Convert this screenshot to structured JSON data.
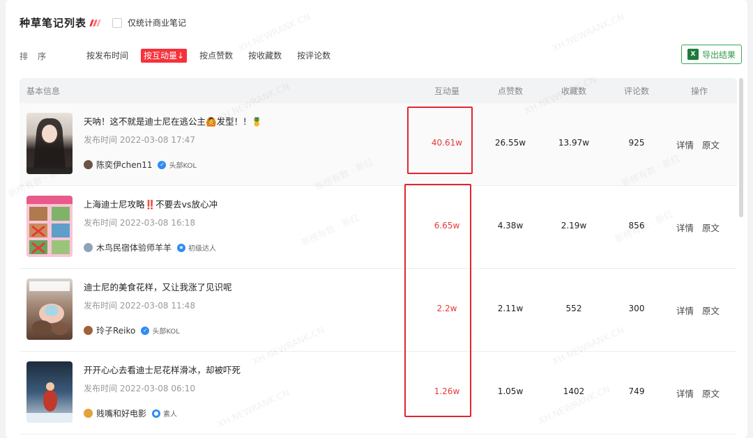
{
  "header": {
    "title": "种草笔记列表",
    "checkbox_label": "仅统计商业笔记"
  },
  "sort": {
    "label": "排序",
    "options": [
      "按发布时间",
      "按互动量↓",
      "按点赞数",
      "按收藏数",
      "按评论数"
    ],
    "active_index": 1
  },
  "export": {
    "label": "导出结果",
    "icon": "excel-icon"
  },
  "table": {
    "headers": {
      "info": "基本信息",
      "interactions": "互动量",
      "likes": "点赞数",
      "favorites": "收藏数",
      "comments": "评论数",
      "actions": "操作"
    },
    "rows": [
      {
        "title": "天呐！这不就是迪士尼在逃公主🙆发型！！🍍",
        "time": "发布时间 2022-03-08 17:47",
        "author": "陈奕伊chen11",
        "badge": "头部KOL",
        "interactions": "40.61w",
        "likes": "26.55w",
        "favorites": "13.97w",
        "comments": "925",
        "detail": "详情",
        "original": "原文"
      },
      {
        "title": "上海迪士尼攻略‼️不要去vs放心冲",
        "time": "发布时间 2022-03-08 16:18",
        "author": "木鸟民宿体验师羊羊",
        "badge": "初级达人",
        "interactions": "6.65w",
        "likes": "4.38w",
        "favorites": "2.19w",
        "comments": "856",
        "detail": "详情",
        "original": "原文"
      },
      {
        "title": "迪士尼的美食花样，又让我涨了见识呢",
        "time": "发布时间 2022-03-08 11:48",
        "author": "玲子Reiko",
        "badge": "头部KOL",
        "interactions": "2.2w",
        "likes": "2.11w",
        "favorites": "552",
        "comments": "300",
        "detail": "详情",
        "original": "原文"
      },
      {
        "title": "开开心心去看迪士尼花样滑冰，却被吓死",
        "time": "发布时间 2022-03-08 06:10",
        "author": "贱嘴和好电影",
        "badge": "素人",
        "interactions": "1.26w",
        "likes": "1.05w",
        "favorites": "1402",
        "comments": "749",
        "detail": "详情",
        "original": "原文"
      }
    ]
  },
  "watermark": {
    "text_a": "XH.NEWRANK.CN",
    "text_b": "新榜有数 · 新红"
  },
  "colors": {
    "accent": "#f5313b",
    "export_green": "#34a853",
    "highlight_box": "#e0262d"
  }
}
